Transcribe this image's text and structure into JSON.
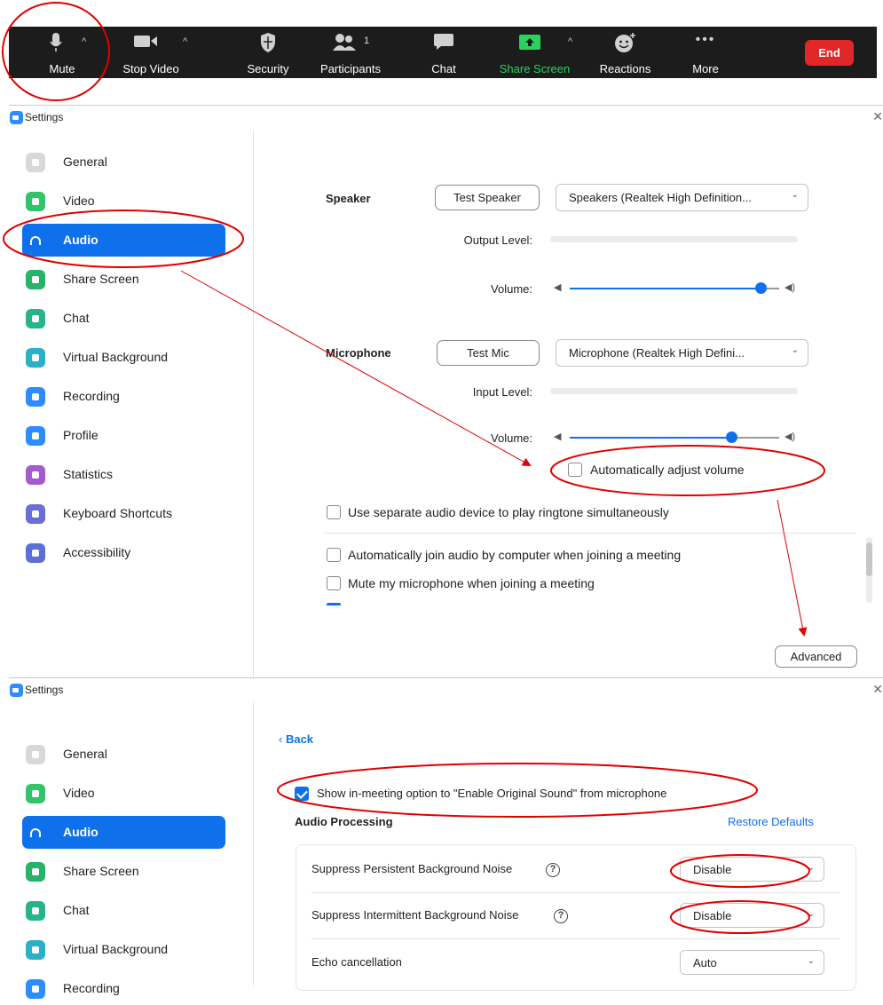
{
  "toolbar": {
    "mute": "Mute",
    "stop_video": "Stop Video",
    "security": "Security",
    "participants": "Participants",
    "participants_count": "1",
    "chat": "Chat",
    "share_screen": "Share Screen",
    "reactions": "Reactions",
    "more": "More",
    "end": "End",
    "colors": {
      "background": "#1c1c1c",
      "share_green": "#2bd25b",
      "end_red": "#e02828"
    }
  },
  "settings_window_1": {
    "title": "Settings",
    "sidebar": [
      {
        "label": "General",
        "icon": "gear-icon",
        "color": "#d8d8d8"
      },
      {
        "label": "Video",
        "icon": "video-camera-icon",
        "color": "#33c36b"
      },
      {
        "label": "Audio",
        "icon": "headphones-icon",
        "color": "#0e71eb",
        "active": true
      },
      {
        "label": "Share Screen",
        "icon": "share-screen-icon",
        "color": "#27b36a"
      },
      {
        "label": "Chat",
        "icon": "chat-icon",
        "color": "#25b58a"
      },
      {
        "label": "Virtual Background",
        "icon": "virtual-background-icon",
        "color": "#2ab1c6"
      },
      {
        "label": "Recording",
        "icon": "recording-icon",
        "color": "#2d8cff"
      },
      {
        "label": "Profile",
        "icon": "profile-icon",
        "color": "#2d8cff"
      },
      {
        "label": "Statistics",
        "icon": "statistics-icon",
        "color": "#a45bd1"
      },
      {
        "label": "Keyboard Shortcuts",
        "icon": "keyboard-icon",
        "color": "#6b6ed6"
      },
      {
        "label": "Accessibility",
        "icon": "accessibility-icon",
        "color": "#5b6fd6"
      }
    ],
    "speaker": {
      "label": "Speaker",
      "test_button": "Test Speaker",
      "device": "Speakers (Realtek High Definition...",
      "output_level_label": "Output Level:",
      "volume_label": "Volume:",
      "volume_fraction": 0.91
    },
    "microphone": {
      "label": "Microphone",
      "test_button": "Test Mic",
      "device": "Microphone (Realtek High Defini...",
      "input_level_label": "Input Level:",
      "volume_label": "Volume:",
      "volume_fraction": 0.77,
      "auto_adjust_label": "Automatically adjust volume",
      "auto_adjust_checked": false
    },
    "options": [
      {
        "label": "Use separate audio device to play ringtone simultaneously",
        "checked": false
      },
      {
        "label": "Automatically join audio by computer when joining a meeting",
        "checked": false
      },
      {
        "label": "Mute my microphone when joining a meeting",
        "checked": false
      }
    ],
    "advanced_button": "Advanced"
  },
  "settings_window_2": {
    "title": "Settings",
    "sidebar": [
      {
        "label": "General",
        "icon": "gear-icon",
        "color": "#d8d8d8"
      },
      {
        "label": "Video",
        "icon": "video-camera-icon",
        "color": "#33c36b"
      },
      {
        "label": "Audio",
        "icon": "headphones-icon",
        "color": "#0e71eb",
        "active": true
      },
      {
        "label": "Share Screen",
        "icon": "share-screen-icon",
        "color": "#27b36a"
      },
      {
        "label": "Chat",
        "icon": "chat-icon",
        "color": "#25b58a"
      },
      {
        "label": "Virtual Background",
        "icon": "virtual-background-icon",
        "color": "#2ab1c6"
      },
      {
        "label": "Recording",
        "icon": "recording-icon",
        "color": "#2d8cff"
      }
    ],
    "back_link": "Back",
    "original_sound_option": "Show in-meeting option to \"Enable Original Sound\" from microphone",
    "original_sound_checked": true,
    "audio_processing_title": "Audio Processing",
    "restore_defaults": "Restore Defaults",
    "rows": [
      {
        "label": "Suppress Persistent Background Noise",
        "help": "?",
        "value": "Disable"
      },
      {
        "label": "Suppress Intermittent Background Noise",
        "help": "?",
        "value": "Disable"
      },
      {
        "label": "Echo cancellation",
        "value": "Auto"
      }
    ]
  },
  "annotation_color": "#e00000"
}
